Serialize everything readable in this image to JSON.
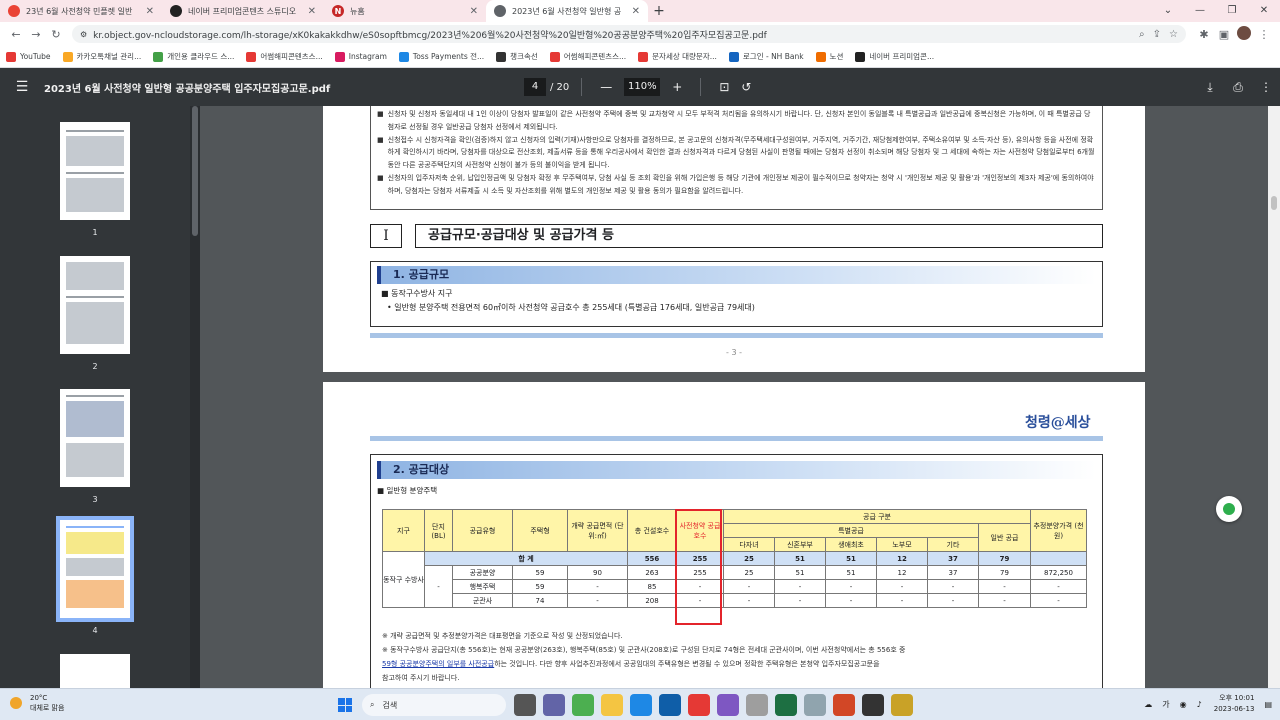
{
  "browser": {
    "tabs": [
      {
        "label": "23년 6월 사전청약 민플렛 일반",
        "favicon_color": "#ea4335"
      },
      {
        "label": "네이버 프리미엄콘텐츠 스튜디오",
        "favicon_color": "#222222"
      },
      {
        "label": "뉴홈",
        "favicon_color": "#c62828"
      },
      {
        "label": "2023년 6월 사전청약 일반형 공",
        "favicon_color": "#5f6368"
      }
    ],
    "active_tab_index": 3,
    "new_tab": "+",
    "url": "kr.object.gov-ncloudstorage.com/lh-storage/xK0kakakkdhw/eS0sopftbmcg/2023년%206월%20사전청약%20일반형%20공공분양주택%20입주자모집공고문.pdf",
    "bookmarks": [
      {
        "label": "YouTube",
        "color": "#e53935"
      },
      {
        "label": "카카오톡채널 관리...",
        "color": "#f9a825"
      },
      {
        "label": "개인용 클라우드 스...",
        "color": "#43a047"
      },
      {
        "label": "어썸해피콘텐츠스...",
        "color": "#e53935"
      },
      {
        "label": "Instagram",
        "color": "#d81b60"
      },
      {
        "label": "Toss Payments 전...",
        "color": "#1e88e5"
      },
      {
        "label": "챙크속선",
        "color": "#333333"
      },
      {
        "label": "어썸해피콘텐츠스...",
        "color": "#e53935"
      },
      {
        "label": "문자세상 대량문자...",
        "color": "#e53935"
      },
      {
        "label": "로그인 - NH Bank",
        "color": "#1565c0"
      },
      {
        "label": "노션",
        "color": "#ef6c00"
      },
      {
        "label": "네이버 프리미엄콘...",
        "color": "#222222"
      }
    ]
  },
  "pdf": {
    "title": "2023년 6월 사전청약 일반형 공공분양주택 입주자모집공고문.pdf",
    "page_current": "4",
    "page_total": "/ 20",
    "zoom": "110%",
    "thumbnails": [
      "1",
      "2",
      "3",
      "4"
    ],
    "selected_thumbnail": "4"
  },
  "page3": {
    "notices": [
      "신청자 및 신청자 동일세대 내 1인 이상이 당첨자 발표일이 같은 사전청약 주택에 중복 및 교차청약 시 모두 부적격 처리됨을 유의하시기 바랍니다. 단, 신청자 본인이 동일블록 내 특별공급과 일반공급에 중복신청은 가능하며, 이 때 특별공급 당첨자로 선정될 경우 일반공급 당첨자 선정에서 제외됩니다.",
      "신청접수 시 신청자격을 확인(검증)하지 않고 신청자의 입력(기재)사항만으로 당첨자를 결정하므로, 본 공고문의 신청자격(무주택세대구성원여부, 거주지역, 거주기간, 재당첨제한여부, 주택소유여부 및 소득·자산 등), 유의사항 등을 사전에 정확하게 확인하시기 바라며, 당첨자를 대상으로 전산조회, 제출서류 등을 통해 우리공사에서 확인한 결과 신청자격과 다르게 당첨된 사실이 판명될 때에는 당첨자 선정이 취소되며 해당 당첨자 및 그 세대에 속하는 자는 사전청약 당첨일로부터 6개월 동안 다른 공공주택단지의 사전청약 신청이 불가 등의 불이익을 받게 됩니다.",
      "신청자의 입주자저축 순위, 납입인정금액 및 당첨자 확정 후 무주택여부, 당첨 사실 등 조회 확인을 위해 가입은행 등 해당 기관에 개인정보 제공이 필수적이므로 청약자는 청약 시 '개인정보 제공 및 활용'과 '개인정보의 제3자 제공'에 동의하여야 하며, 당첨자는 당첨자 서류제출 시 소득 및 자산조회를 위해 별도의 개인정보 제공 및 활용 동의가 필요함을 알려드립니다."
    ],
    "section_num": "I",
    "section_title": "공급규모·공급대상 및 공급가격 등",
    "sub1": "1. 공급규모",
    "district": "■ 동작구수방사 지구",
    "supply_line": "• 일반형 분양주택 전용면적 60㎡이하 사전청약 공급호수 총 255세대 (특별공급 176세대, 일반공급 79세대)",
    "page_num": "- 3 -"
  },
  "page4": {
    "logo": "청령@세상",
    "sub2": "2. 공급대상",
    "caption": "■ 일반형 분양주택",
    "headers": {
      "region": "지구",
      "block": "단지 (BL)",
      "supply_type": "공급유형",
      "house_type": "주택형",
      "area": "개략 공급면적 (단위:㎡)",
      "total_units": "총 건설호수",
      "pre_units": "사전청약 공급호수",
      "supply_div": "공급 구분",
      "special": "특별공급",
      "newlywed": "신혼부부",
      "multichild": "다자녀",
      "firsttime": "생애최초",
      "elderly": "노부모",
      "etc": "기타",
      "general": "일반 공급",
      "price": "추정분양가격 (천원)"
    },
    "total_row": {
      "label": "합 계",
      "total_units": "556",
      "pre_units": "255",
      "multichild": "25",
      "newlywed": "51",
      "firsttime": "51",
      "elderly": "12",
      "etc": "37",
      "general": "79",
      "price": ""
    },
    "region_name": "동작구 수방사",
    "block_val": "-",
    "rows": [
      {
        "type": "공공분양",
        "house": "59",
        "area": "90",
        "total": "263",
        "pre": "255",
        "multi": "25",
        "newly": "51",
        "first": "51",
        "elder": "12",
        "etc": "37",
        "gen": "79",
        "price": "872,250"
      },
      {
        "type": "행복주택",
        "house": "59",
        "area": "-",
        "total": "85",
        "pre": "-",
        "multi": "-",
        "newly": "-",
        "first": "-",
        "elder": "-",
        "etc": "-",
        "gen": "-",
        "price": "-"
      },
      {
        "type": "군관사",
        "house": "74",
        "area": "-",
        "total": "208",
        "pre": "-",
        "multi": "-",
        "newly": "-",
        "first": "-",
        "elder": "-",
        "etc": "-",
        "gen": "-",
        "price": "-"
      }
    ],
    "note1": "※ 개략 공급면적 및 추정분양가격은 대표평면을 기준으로 작성 및 산정되었습니다.",
    "note2_a": "※ 동작구수방사 공급단지(총 556호)는 현재 공공분양(263호), 행복주택(85호) 및 군관사(208호)로 구성된 단지로 74형은 전세대 군관사이며, 이번 사전청약에서는 총 556호 중",
    "note2_hl": "59형 공공분양주택의 일부를 사전공급",
    "note2_b": "하는 것입니다. 다만 향후 사업추진과정에서 공공임대의 주택유형은 변경될 수 있으며 정확한 주택유형은 본청약 입주자모집공고문을",
    "note2_c": "참고하여 주시기 바랍니다."
  },
  "taskbar": {
    "temp": "20°C",
    "weather": "대체로 맑음",
    "search": "검색",
    "time": "오후 10:01",
    "date": "2023-06-13",
    "lang": "가"
  }
}
